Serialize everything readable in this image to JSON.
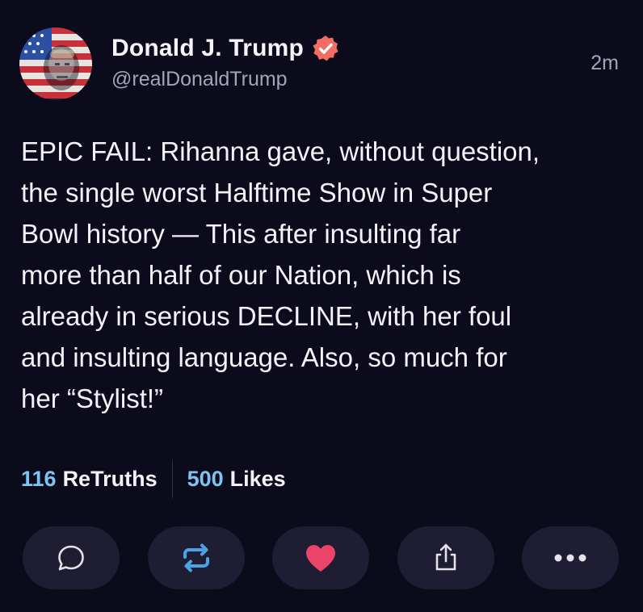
{
  "author": {
    "display_name": "Donald J. Trump",
    "handle": "@realDonaldTrump",
    "verified": true,
    "avatar_icon": "flag-portrait-avatar"
  },
  "post": {
    "time_ago": "2m",
    "text": "EPIC FAIL: Rihanna gave, without question,\nthe single worst Halftime Show in Super\nBowl history — This after insulting far\nmore than half of our Nation, which is\nalready in serious DECLINE, with her foul\nand insulting language. Also, so much for\nher “Stylist!”"
  },
  "stats": {
    "retruths_count": "116",
    "retruths_label": "ReTruths",
    "likes_count": "500",
    "likes_label": "Likes"
  },
  "actions": [
    {
      "name": "reply",
      "icon": "comment-icon"
    },
    {
      "name": "retruth",
      "icon": "repost-icon"
    },
    {
      "name": "like",
      "icon": "heart-icon"
    },
    {
      "name": "share",
      "icon": "share-icon"
    },
    {
      "name": "more",
      "icon": "more-icon"
    }
  ],
  "colors": {
    "background": "#0c0b1c",
    "button_bg": "#1e1d33",
    "accent_blue": "#7cc4f2",
    "verified_orange": "#f36e62",
    "heart": "#ec4368",
    "repost": "#4aa3e3",
    "muted_text": "#a5a4b8"
  }
}
